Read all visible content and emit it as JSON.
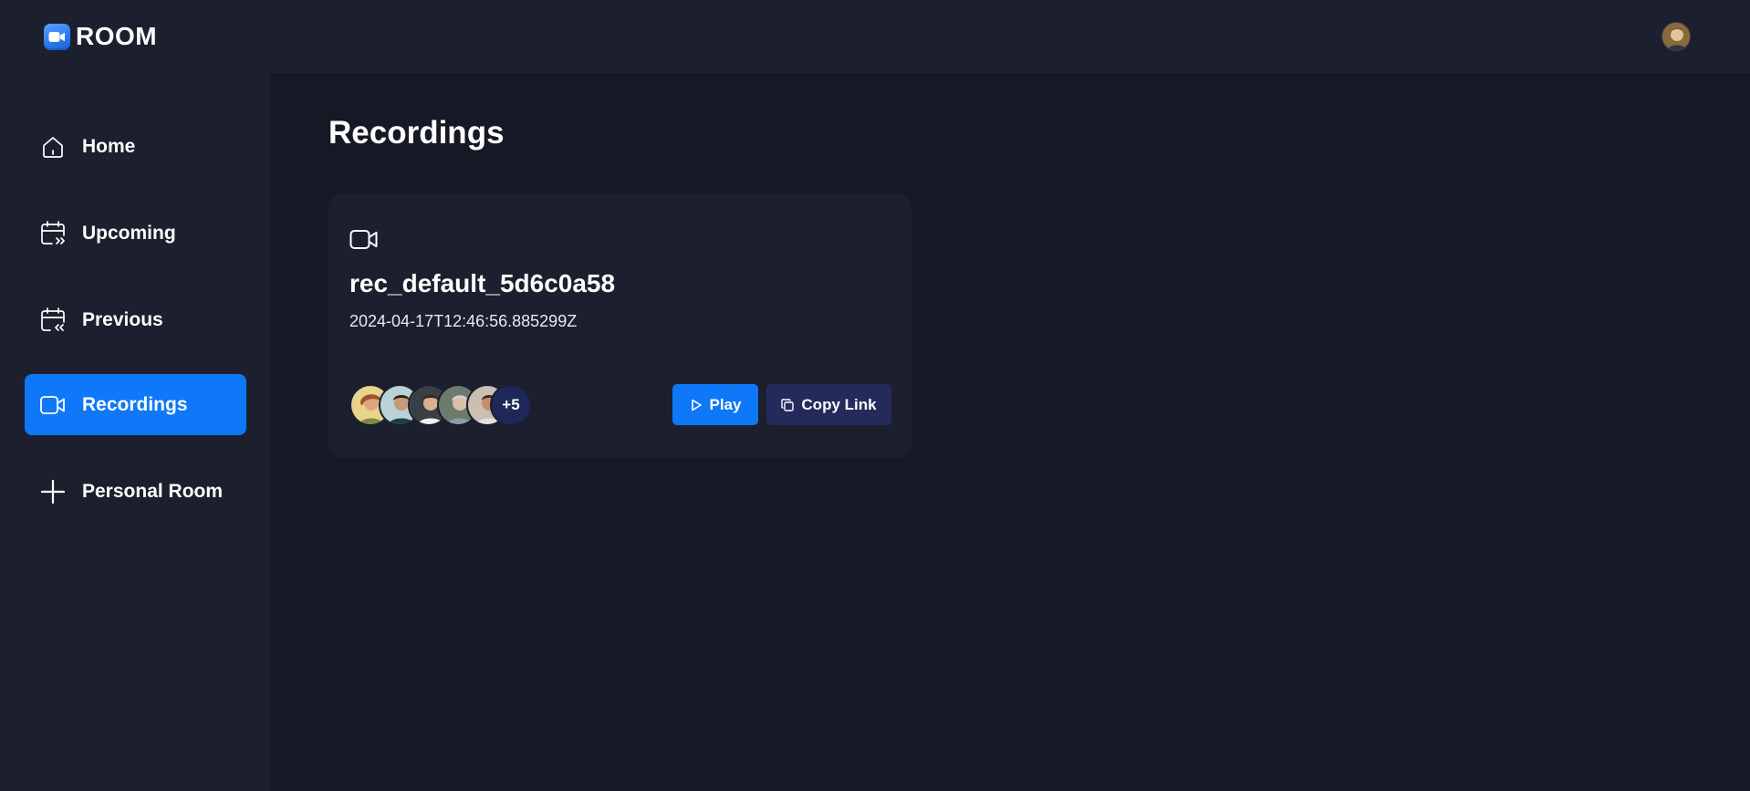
{
  "app": {
    "name": "ROOM",
    "logo_icon": "video-camera-logo-icon"
  },
  "header": {
    "user_avatar": "user-avatar"
  },
  "sidebar": {
    "items": [
      {
        "label": "Home",
        "icon": "home-icon",
        "active": false
      },
      {
        "label": "Upcoming",
        "icon": "calendar-forward-icon",
        "active": false
      },
      {
        "label": "Previous",
        "icon": "calendar-back-icon",
        "active": false
      },
      {
        "label": "Recordings",
        "icon": "video-icon",
        "active": true
      },
      {
        "label": "Personal Room",
        "icon": "plus-icon",
        "active": false
      }
    ]
  },
  "main": {
    "title": "Recordings",
    "cards": [
      {
        "icon": "video-icon",
        "title": "rec_default_5d6c0a58",
        "date": "2024-04-17T12:46:56.885299Z",
        "attendees_more": "+5",
        "play_label": "Play",
        "copy_label": "Copy Link"
      }
    ]
  },
  "colors": {
    "background": "#161925",
    "panel": "#1c1f2e",
    "accent": "#0e78f9",
    "secondary_button": "#252a5c",
    "more_badge": "#1e2757"
  }
}
